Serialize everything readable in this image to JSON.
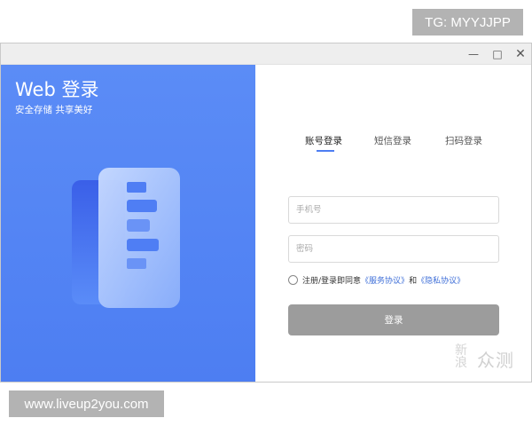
{
  "overlay": {
    "top_badge": "TG: MYYJJPP",
    "bottom_badge": "www.liveup2you.com",
    "watermark_mark": "新浪",
    "watermark_text": "众测"
  },
  "window": {
    "controls": {
      "minimize": "—",
      "maximize": "□",
      "close": "✕"
    }
  },
  "brand": {
    "title": "Web 登录",
    "subtitle": "安全存储 共享美好",
    "colors": {
      "panel": "#5b8cf6",
      "accent": "#4d7ef2"
    }
  },
  "tabs": [
    {
      "label": "账号登录",
      "active": true
    },
    {
      "label": "短信登录",
      "active": false
    },
    {
      "label": "扫码登录",
      "active": false
    }
  ],
  "form": {
    "phone_placeholder": "手机号",
    "password_placeholder": "密码",
    "agree_prefix": "注册/登录即同意",
    "service_link": "《服务协议》",
    "agree_and": "和",
    "privacy_link": "《隐私协议》",
    "login_label": "登录"
  }
}
